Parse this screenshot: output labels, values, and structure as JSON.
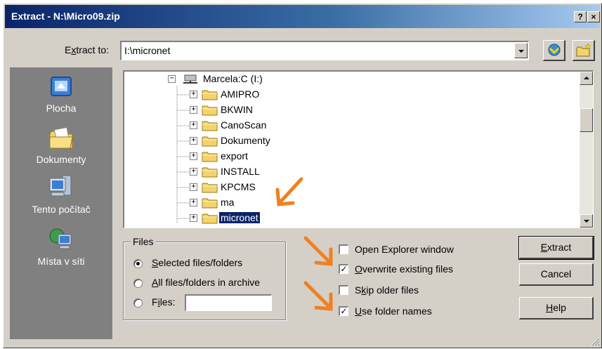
{
  "window": {
    "title": "Extract - N:\\Micro09.zip",
    "help_btn": "?",
    "close_btn": "×"
  },
  "extract_to": {
    "label_pre": "E",
    "label_u": "x",
    "label_post": "tract to:",
    "value": "I:\\micronet"
  },
  "places": [
    {
      "label": "Plocha",
      "icon": "desktop-icon"
    },
    {
      "label": "Dokumenty",
      "icon": "documents-icon"
    },
    {
      "label": "Tento počítač",
      "icon": "computer-icon"
    },
    {
      "label": "Místa v síti",
      "icon": "network-icon"
    }
  ],
  "tree": {
    "root": "Marcela:C (I:)",
    "items": [
      {
        "label": "AMIPRO",
        "selected": false
      },
      {
        "label": "BKWIN",
        "selected": false
      },
      {
        "label": "CanoScan",
        "selected": false
      },
      {
        "label": "Dokumenty",
        "selected": false
      },
      {
        "label": "export",
        "selected": false
      },
      {
        "label": "INSTALL",
        "selected": false
      },
      {
        "label": "KPCMS",
        "selected": false
      },
      {
        "label": "ma",
        "selected": false
      },
      {
        "label": "micronet",
        "selected": true
      }
    ]
  },
  "files_group": {
    "legend": "Files",
    "options": [
      {
        "u": "S",
        "rest": "elected files/folders",
        "checked": true
      },
      {
        "u": "A",
        "rest": "ll files/folders in archive",
        "checked": false
      },
      {
        "pre": "F",
        "u": "i",
        "rest": "les:",
        "checked": false
      }
    ],
    "files_value": ""
  },
  "options": [
    {
      "u": "",
      "text": "Open Explorer window",
      "checked": false
    },
    {
      "u": "O",
      "text": "verwrite existing files",
      "checked": true
    },
    {
      "pre": "S",
      "u": "k",
      "text": "ip older files",
      "checked": false
    },
    {
      "u": "U",
      "text": "se folder names",
      "checked": true
    }
  ],
  "buttons": {
    "extract_u": "E",
    "extract_rest": "xtract",
    "cancel": "Cancel",
    "help_u": "H",
    "help_rest": "elp"
  },
  "colors": {
    "titlebar_start": "#0a246a",
    "selection": "#0a246a",
    "annotation_arrow": "#f08020",
    "dialog_face": "#d4d0c8"
  }
}
